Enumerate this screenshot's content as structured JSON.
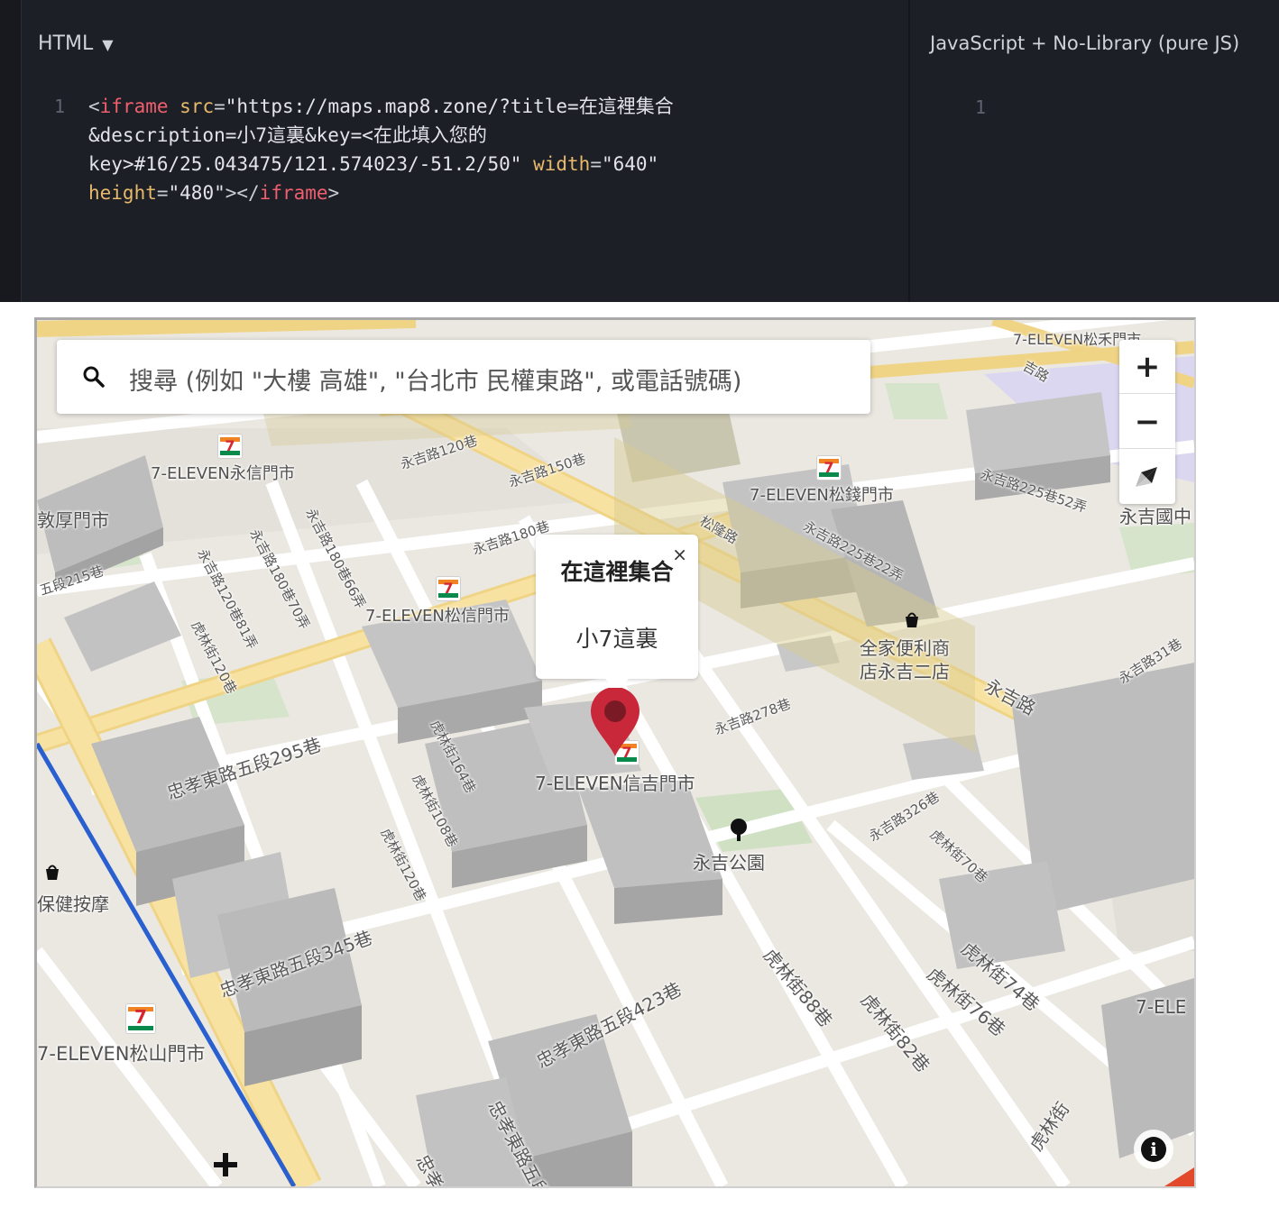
{
  "editor": {
    "html_pane": {
      "title": "HTML",
      "caret": "▼",
      "line_number": "1",
      "code": {
        "open_bracket": "<",
        "tag": "iframe",
        "attr_src": "src",
        "eq": "=",
        "src_value": "\"https://maps.map8.zone/?title=在這裡集合",
        "src_value_2": "&description=小7這裏&key=<在此填入您的",
        "src_value_3": "key>#16/25.043475/121.574023/-51.2/50\"",
        "attr_width": "width",
        "width_value": "\"640\"",
        "attr_height": "height",
        "height_value": "\"480\"",
        "close_open": "></",
        "close_bracket": ">"
      }
    },
    "js_pane": {
      "title": "JavaScript + No-Library (pure JS)",
      "line_number": "1"
    }
  },
  "map": {
    "search": {
      "icon": "search-icon",
      "placeholder": "搜尋 (例如 \"大樓 高雄\", \"台北市 民權東路\", 或電話號碼)"
    },
    "controls": {
      "zoom_in": "+",
      "zoom_out": "−",
      "compass": "compass-icon"
    },
    "popup": {
      "title": "在這裡集合",
      "description": "小7這裏",
      "close": "×"
    },
    "pois": [
      {
        "name": "7-ELEVEN永信門市",
        "icon": "seven-eleven-icon"
      },
      {
        "name": "7-ELEVEN松錢門市",
        "icon": "seven-eleven-icon"
      },
      {
        "name": "7-ELEVEN松信門市",
        "icon": "seven-eleven-icon"
      },
      {
        "name": "7-ELEVEN信吉門市",
        "icon": "seven-eleven-icon"
      },
      {
        "name": "7-ELEVEN松山門市",
        "icon": "seven-eleven-icon"
      },
      {
        "name": "7-ELEVEN松禾門市",
        "icon": "seven-eleven-icon"
      },
      {
        "name": "7-ELE",
        "icon": "seven-eleven-icon"
      },
      {
        "name": "全家便利商",
        "name_2": "店永吉二店",
        "icon": "shopping-bag-icon"
      },
      {
        "name": "永吉公園",
        "icon": "tree-icon"
      },
      {
        "name": "保健按摩",
        "icon": "shopping-bag-icon"
      },
      {
        "name": "永吉國中"
      },
      {
        "name": "敦厚門市"
      }
    ],
    "streets": [
      "永吉路120巷",
      "永吉路150巷",
      "永吉路180巷",
      "永吉路180巷66弄",
      "永吉路180巷70弄",
      "永吉路120巷81弄",
      "虎林街120巷",
      "忠孝東路五段295巷",
      "永吉路278巷",
      "虎林街164巷",
      "虎林街108巷",
      "虎林街120巷",
      "忠孝東路五段345巷",
      "忠孝東路五段423巷",
      "永吉路326巷",
      "虎林街70巷",
      "虎林街88巷",
      "虎林街82巷",
      "虎林街74巷",
      "虎林街76巷",
      "永吉路225巷52弄",
      "永吉路225巷22弄",
      "永吉路",
      "永吉路31巷",
      "松隆路",
      "虎林街",
      "忠孝東路五段",
      "五段215巷",
      "忠孝",
      "吉路"
    ],
    "info_button": "info-icon",
    "colors": {
      "accent_marker": "#c8283a",
      "major_road": "#f6d98a",
      "transit_line": "#2a5fcf"
    }
  }
}
